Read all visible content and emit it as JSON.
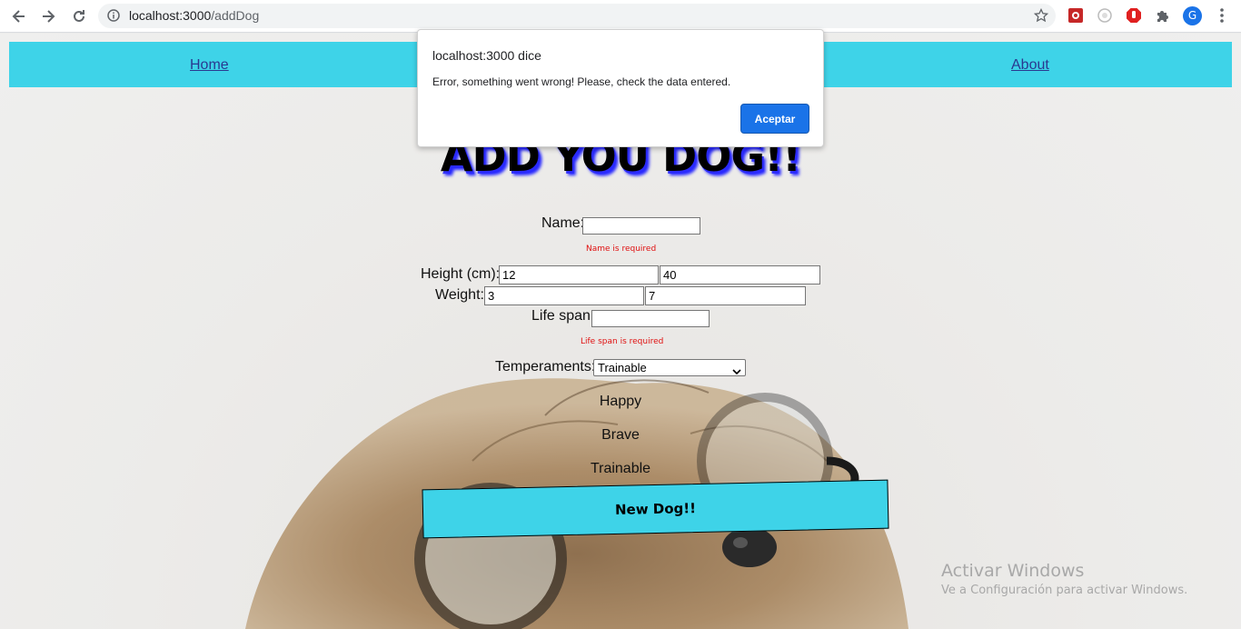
{
  "browser": {
    "url_host": "localhost:3000",
    "url_path": "/addDog",
    "avatar_letter": "G",
    "icons": [
      "back-icon",
      "forward-icon",
      "reload-icon",
      "info-icon",
      "star-icon",
      "extension-icon",
      "puzzle-icon",
      "menu-icon"
    ]
  },
  "navbar": {
    "home": "Home",
    "about": "About"
  },
  "form": {
    "title": "ADD YOU DOG!!",
    "name_label": "Name:",
    "name_value": "",
    "name_error": "Name is required",
    "height_label": "Height (cm):",
    "height_min": "12",
    "height_max": "40",
    "weight_label": "Weight:",
    "weight_min": "3",
    "weight_max": "7",
    "lifespan_label": "Life span:",
    "lifespan_value": "",
    "lifespan_error": "Life span is required",
    "temperaments_label": "Temperaments:",
    "temperaments_selected": "Trainable",
    "temperaments_list": [
      "Happy",
      "Brave",
      "Trainable"
    ],
    "submit": "New Dog!!"
  },
  "dialog": {
    "title": "localhost:3000 dice",
    "message": "Error, something went wrong! Please, check the data entered.",
    "button": "Aceptar"
  },
  "watermark": {
    "line1": "Activar Windows",
    "line2": "Ve a Configuración para activar Windows."
  },
  "colors": {
    "accent": "#3ed3e8",
    "error": "#e01010",
    "dialog_button": "#1a73e8"
  }
}
